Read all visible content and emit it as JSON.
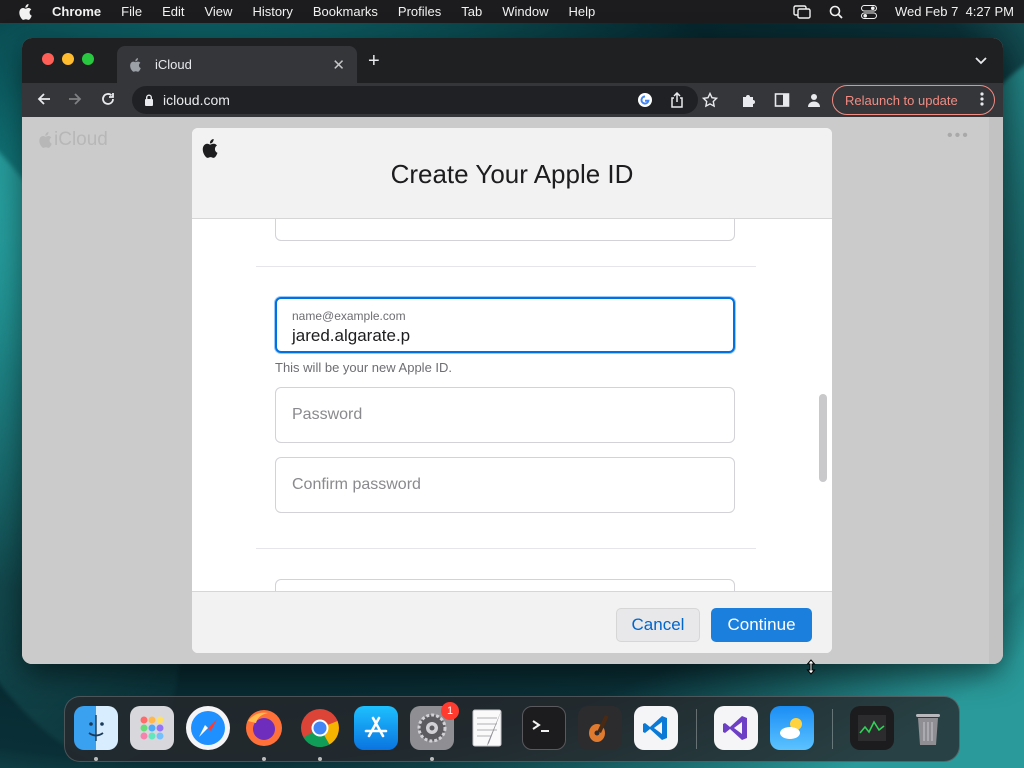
{
  "menubar": {
    "app_name": "Chrome",
    "menus": [
      "File",
      "Edit",
      "View",
      "History",
      "Bookmarks",
      "Profiles",
      "Tab",
      "Window",
      "Help"
    ],
    "clock": "Wed Feb 7  4:27 PM"
  },
  "browser": {
    "tab_title": "iCloud",
    "url": "icloud.com",
    "relaunch_label": "Relaunch to update"
  },
  "page": {
    "logo_text": "iCloud",
    "more": "•••"
  },
  "modal": {
    "title": "Create Your Apple ID",
    "email_field": {
      "placeholder": "name@example.com",
      "value": "jared.algarate.p"
    },
    "email_helper": "This will be your new Apple ID.",
    "password_placeholder": "Password",
    "confirm_password_placeholder": "Confirm password",
    "cancel_label": "Cancel",
    "continue_label": "Continue"
  },
  "dock": {
    "apps": [
      "Finder",
      "Launchpad",
      "Safari",
      "Firefox",
      "Chrome",
      "App Store",
      "System Preferences",
      "TextEdit",
      "Terminal",
      "GarageBand",
      "Visual Studio Code",
      "Visual Studio",
      "Weather",
      "Activity Monitor",
      "Trash"
    ],
    "system_prefs_badge": "1"
  },
  "colors": {
    "accent": "#0071e3",
    "continue_button": "#1a7fdd",
    "relaunch": "#f28b82"
  }
}
